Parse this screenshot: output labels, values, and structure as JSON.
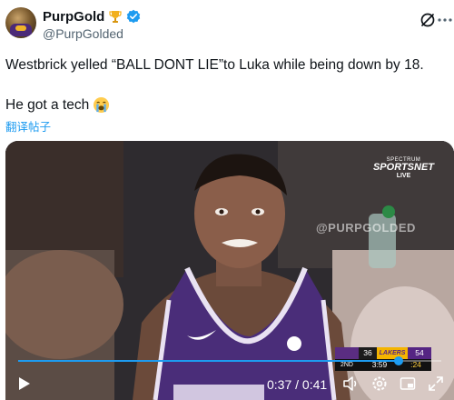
{
  "author": {
    "display_name": "PurpGold",
    "handle": "@PurpGolded",
    "badge_icons": [
      "trophy-icon",
      "verified-badge-icon"
    ]
  },
  "tweet": {
    "line1": "Westbrick yelled “BALL DONT LIE”to Luka while being down by 18.",
    "line2": "He got a tech",
    "emoji_icon": "loudly-crying-face-icon",
    "translate_label": "翻译帖子"
  },
  "video": {
    "broadcaster": {
      "line1": "SPECTRUM",
      "line2": "SPORTSNET",
      "line3": "LIVE"
    },
    "watermark": "@PURPGOLDED",
    "scorebug": {
      "team1_score": "36",
      "team2_name": "LAKERS",
      "team2_score": "54",
      "quarter": "2ND",
      "clock": "3:59",
      "shot_clock": ":24"
    },
    "progress_fraction": 0.9,
    "time_display": "0:37 / 0:41",
    "colors": {
      "accent": "#1d9bf0",
      "kings_purple": "#5a2d82",
      "lakers_gold": "#f4b400"
    }
  }
}
